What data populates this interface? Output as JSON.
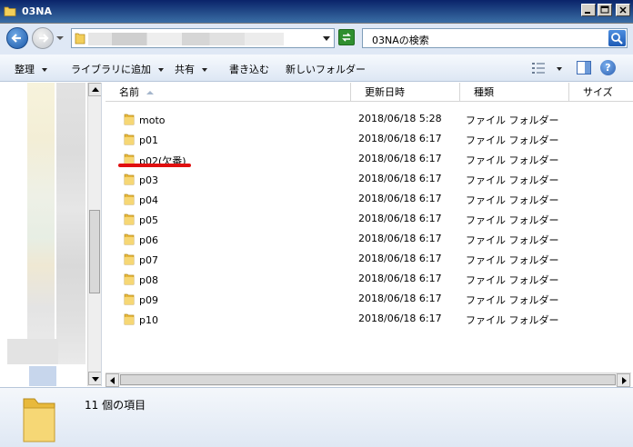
{
  "window": {
    "title": "03NA"
  },
  "address": {
    "search_placeholder": "03NAの検索"
  },
  "toolbar": {
    "organize": "整理",
    "add_to_library": "ライブラリに追加",
    "share": "共有",
    "burn": "書き込む",
    "new_folder": "新しいフォルダー"
  },
  "columns": {
    "name": "名前",
    "modified": "更新日時",
    "type": "種類",
    "size": "サイズ"
  },
  "files": [
    {
      "name": "moto",
      "modified": "2018/06/18 5:28",
      "type": "ファイル フォルダー"
    },
    {
      "name": "p01",
      "modified": "2018/06/18 6:17",
      "type": "ファイル フォルダー"
    },
    {
      "name": "p02(欠番)",
      "modified": "2018/06/18 6:17",
      "type": "ファイル フォルダー"
    },
    {
      "name": "p03",
      "modified": "2018/06/18 6:17",
      "type": "ファイル フォルダー"
    },
    {
      "name": "p04",
      "modified": "2018/06/18 6:17",
      "type": "ファイル フォルダー"
    },
    {
      "name": "p05",
      "modified": "2018/06/18 6:17",
      "type": "ファイル フォルダー"
    },
    {
      "name": "p06",
      "modified": "2018/06/18 6:17",
      "type": "ファイル フォルダー"
    },
    {
      "name": "p07",
      "modified": "2018/06/18 6:17",
      "type": "ファイル フォルダー"
    },
    {
      "name": "p08",
      "modified": "2018/06/18 6:17",
      "type": "ファイル フォルダー"
    },
    {
      "name": "p09",
      "modified": "2018/06/18 6:17",
      "type": "ファイル フォルダー"
    },
    {
      "name": "p10",
      "modified": "2018/06/18 6:17",
      "type": "ファイル フォルダー"
    }
  ],
  "details": {
    "item_count": "11 個の項目"
  },
  "colors": {
    "highlight_underline": "#e01010",
    "folder_yellow": "#f3cf5a"
  },
  "icons": {
    "folder": "folder-icon",
    "back": "back-arrow-icon",
    "forward": "forward-arrow-icon",
    "refresh": "refresh-icon",
    "search": "search-icon",
    "views": "views-icon",
    "preview_pane": "preview-pane-icon",
    "help": "help-icon"
  }
}
